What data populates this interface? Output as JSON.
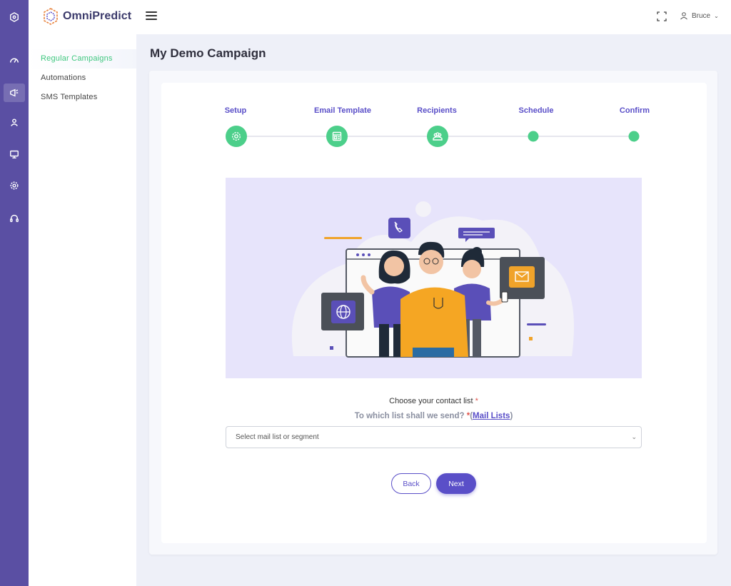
{
  "app": {
    "name": "OmniPredict"
  },
  "topbar": {
    "user_name": "Bruce"
  },
  "rail": {
    "icons": [
      "logo-hex-icon",
      "dashboard-icon",
      "campaign-icon",
      "contacts-icon",
      "monitor-icon",
      "settings-icon",
      "support-icon"
    ]
  },
  "subnav": {
    "items": [
      {
        "label": "Regular Campaigns",
        "active": true
      },
      {
        "label": "Automations",
        "active": false
      },
      {
        "label": "SMS Templates",
        "active": false
      }
    ]
  },
  "page": {
    "title": "My Demo Campaign"
  },
  "stepper": {
    "steps": [
      {
        "label": "Setup",
        "icon": "gear-icon"
      },
      {
        "label": "Email Template",
        "icon": "template-icon"
      },
      {
        "label": "Recipients",
        "icon": "users-icon"
      },
      {
        "label": "Schedule",
        "icon": ""
      },
      {
        "label": "Confirm",
        "icon": ""
      }
    ]
  },
  "form": {
    "choose_label": "Choose your contact list",
    "required_mark": "*",
    "which_label": "To which list shall we send?",
    "which_required": "*",
    "open_paren": "(",
    "mail_lists_link": "Mail Lists",
    "close_paren": ")",
    "select_placeholder": "Select mail list or segment"
  },
  "actions": {
    "back_label": "Back",
    "next_label": "Next"
  },
  "colors": {
    "rail": "#5a4fa3",
    "accent": "#5a4fc8",
    "step_green": "#4ccf8a",
    "active_nav": "#3fc77f"
  }
}
